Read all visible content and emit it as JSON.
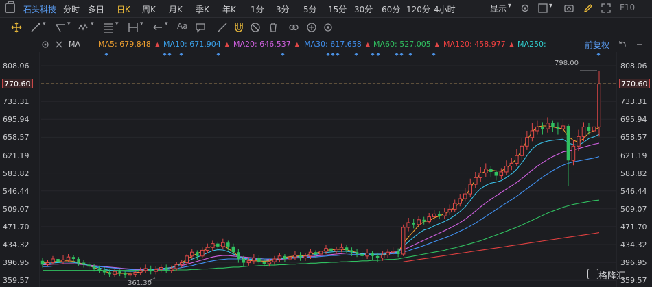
{
  "header": {
    "stock_name": "石头科技",
    "periods": [
      "分时",
      "多日",
      "日K",
      "周K",
      "月K",
      "季K",
      "年K",
      "1分",
      "3分",
      "5分",
      "15分",
      "30分",
      "60分",
      "120分",
      "4小时"
    ],
    "active_period": "日K",
    "display_label": "显示",
    "f10_label": "F10"
  },
  "indicator_row": {
    "ma_label": "MA",
    "items": [
      {
        "label": "MA5: 679.848",
        "color": "#f0a030"
      },
      {
        "label": "MA10: 671.904",
        "color": "#3aa0e8"
      },
      {
        "label": "MA20: 646.537",
        "color": "#d060e0"
      },
      {
        "label": "MA30: 617.658",
        "color": "#4090f0"
      },
      {
        "label": "MA60: 527.005",
        "color": "#30c060"
      },
      {
        "label": "MA120: 458.977",
        "color": "#f04040"
      },
      {
        "label": "MA250:",
        "color": "#30d0d0"
      }
    ],
    "adjust_label": "前复权"
  },
  "price_axis": {
    "labels": [
      "808.06",
      "770.60",
      "733.31",
      "695.94",
      "658.57",
      "621.19",
      "583.82",
      "546.44",
      "509.07",
      "471.70",
      "434.32",
      "396.95",
      "359.57"
    ],
    "current_price": "770.60",
    "high_annotation": "798.00",
    "low_annotation": "361.30"
  },
  "chart_data": {
    "type": "candlestick",
    "ylim": [
      359.57,
      808.06
    ],
    "high_label": 798.0,
    "low_label": 361.3,
    "last_price": 770.6,
    "ma_values": {
      "MA5": 679.848,
      "MA10": 671.904,
      "MA20": 646.537,
      "MA30": 617.658,
      "MA60": 527.005,
      "MA120": 458.977
    },
    "candles": [
      [
        400,
        392,
        406,
        386
      ],
      [
        392,
        396,
        402,
        388
      ],
      [
        396,
        404,
        410,
        392
      ],
      [
        404,
        398,
        408,
        394
      ],
      [
        398,
        402,
        412,
        394
      ],
      [
        402,
        408,
        414,
        398
      ],
      [
        408,
        404,
        412,
        398
      ],
      [
        404,
        396,
        408,
        390
      ],
      [
        396,
        392,
        402,
        386
      ],
      [
        392,
        388,
        398,
        382
      ],
      [
        388,
        384,
        394,
        378
      ],
      [
        384,
        380,
        390,
        374
      ],
      [
        380,
        376,
        386,
        370
      ],
      [
        376,
        372,
        382,
        366
      ],
      [
        372,
        378,
        384,
        366
      ],
      [
        378,
        374,
        382,
        368
      ],
      [
        374,
        370,
        380,
        364
      ],
      [
        370,
        372,
        378,
        362
      ],
      [
        372,
        376,
        380,
        366
      ],
      [
        376,
        380,
        386,
        370
      ],
      [
        380,
        384,
        392,
        374
      ],
      [
        384,
        378,
        390,
        372
      ],
      [
        378,
        382,
        388,
        372
      ],
      [
        382,
        386,
        392,
        376
      ],
      [
        386,
        380,
        392,
        374
      ],
      [
        380,
        384,
        390,
        374
      ],
      [
        384,
        392,
        398,
        380
      ],
      [
        392,
        396,
        402,
        386
      ],
      [
        396,
        410,
        414,
        390
      ],
      [
        410,
        418,
        424,
        404
      ],
      [
        418,
        410,
        422,
        402
      ],
      [
        410,
        422,
        428,
        406
      ],
      [
        422,
        428,
        436,
        416
      ],
      [
        428,
        436,
        442,
        420
      ],
      [
        436,
        430,
        440,
        422
      ],
      [
        430,
        438,
        446,
        424
      ],
      [
        438,
        430,
        442,
        422
      ],
      [
        430,
        418,
        436,
        412
      ],
      [
        418,
        404,
        424,
        396
      ],
      [
        404,
        396,
        410,
        388
      ],
      [
        396,
        400,
        406,
        390
      ],
      [
        400,
        406,
        414,
        394
      ],
      [
        406,
        398,
        412,
        392
      ],
      [
        398,
        394,
        404,
        388
      ],
      [
        394,
        398,
        404,
        388
      ],
      [
        398,
        404,
        410,
        392
      ],
      [
        404,
        410,
        416,
        398
      ],
      [
        410,
        404,
        414,
        398
      ],
      [
        404,
        408,
        414,
        398
      ],
      [
        408,
        412,
        420,
        402
      ],
      [
        412,
        406,
        418,
        400
      ],
      [
        406,
        410,
        416,
        400
      ],
      [
        410,
        418,
        424,
        404
      ],
      [
        418,
        414,
        422,
        406
      ],
      [
        414,
        420,
        428,
        408
      ],
      [
        420,
        426,
        434,
        414
      ],
      [
        426,
        420,
        432,
        412
      ],
      [
        420,
        424,
        430,
        414
      ],
      [
        424,
        428,
        436,
        418
      ],
      [
        428,
        422,
        434,
        416
      ],
      [
        422,
        418,
        428,
        410
      ],
      [
        418,
        414,
        424,
        408
      ],
      [
        414,
        410,
        420,
        404
      ],
      [
        410,
        416,
        424,
        404
      ],
      [
        416,
        410,
        420,
        402
      ],
      [
        410,
        406,
        416,
        398
      ],
      [
        406,
        412,
        420,
        400
      ],
      [
        412,
        418,
        424,
        406
      ],
      [
        418,
        420,
        428,
        412
      ],
      [
        420,
        414,
        426,
        408
      ],
      [
        414,
        470,
        476,
        410
      ],
      [
        470,
        480,
        490,
        462
      ],
      [
        480,
        476,
        488,
        468
      ],
      [
        476,
        486,
        494,
        470
      ],
      [
        486,
        482,
        492,
        476
      ],
      [
        482,
        492,
        500,
        478
      ],
      [
        492,
        498,
        506,
        486
      ],
      [
        498,
        494,
        504,
        488
      ],
      [
        494,
        502,
        510,
        488
      ],
      [
        502,
        508,
        518,
        496
      ],
      [
        508,
        520,
        528,
        502
      ],
      [
        520,
        530,
        540,
        514
      ],
      [
        530,
        540,
        552,
        524
      ],
      [
        540,
        560,
        572,
        534
      ],
      [
        560,
        574,
        586,
        552
      ],
      [
        574,
        584,
        596,
        566
      ],
      [
        584,
        592,
        604,
        576
      ],
      [
        592,
        586,
        598,
        576
      ],
      [
        586,
        578,
        590,
        568
      ],
      [
        578,
        586,
        594,
        570
      ],
      [
        586,
        598,
        610,
        580
      ],
      [
        598,
        604,
        616,
        590
      ],
      [
        604,
        620,
        634,
        598
      ],
      [
        620,
        640,
        656,
        612
      ],
      [
        640,
        658,
        672,
        632
      ],
      [
        658,
        672,
        688,
        650
      ],
      [
        672,
        680,
        694,
        664
      ],
      [
        680,
        676,
        690,
        664
      ],
      [
        676,
        688,
        700,
        668
      ],
      [
        688,
        680,
        694,
        670
      ],
      [
        680,
        676,
        690,
        664
      ],
      [
        676,
        682,
        696,
        668
      ],
      [
        682,
        610,
        686,
        556
      ],
      [
        610,
        640,
        652,
        600
      ],
      [
        640,
        660,
        674,
        630
      ],
      [
        660,
        680,
        690,
        650
      ],
      [
        680,
        672,
        688,
        664
      ],
      [
        672,
        680,
        692,
        664
      ],
      [
        680,
        770,
        798,
        660
      ]
    ],
    "ma_series": {
      "MA5": [
        396,
        397,
        398,
        399,
        400,
        400,
        399,
        396,
        393,
        390,
        386,
        382,
        378,
        375,
        374,
        374,
        374,
        374,
        375,
        377,
        380,
        382,
        383,
        384,
        384,
        386,
        390,
        396,
        403,
        410,
        415,
        420,
        426,
        432,
        434,
        432,
        426,
        418,
        410,
        404,
        401,
        400,
        400,
        399,
        400,
        403,
        405,
        407,
        409,
        410,
        410,
        411,
        414,
        416,
        419,
        422,
        423,
        424,
        424,
        423,
        420,
        417,
        414,
        413,
        412,
        412,
        412,
        414,
        416,
        418,
        436,
        450,
        462,
        474,
        482,
        484,
        490,
        494,
        498,
        504,
        512,
        522,
        534,
        552,
        570,
        582,
        588,
        590,
        588,
        588,
        594,
        602,
        614,
        632,
        652,
        670,
        680,
        682,
        682,
        680,
        678,
        676,
        660,
        652,
        648,
        656,
        668,
        672,
        680
      ],
      "MA20": [
        392,
        392,
        393,
        393,
        394,
        394,
        394,
        393,
        392,
        391,
        390,
        389,
        388,
        387,
        386,
        385,
        384,
        383,
        382,
        382,
        382,
        382,
        383,
        384,
        385,
        386,
        388,
        390,
        393,
        396,
        399,
        402,
        405,
        408,
        410,
        411,
        411,
        410,
        409,
        408,
        407,
        406,
        405,
        404,
        403,
        403,
        403,
        404,
        405,
        406,
        407,
        408,
        409,
        410,
        411,
        412,
        413,
        414,
        415,
        416,
        416,
        416,
        416,
        416,
        416,
        416,
        416,
        417,
        418,
        419,
        423,
        428,
        433,
        438,
        443,
        448,
        453,
        458,
        463,
        468,
        474,
        480,
        487,
        495,
        504,
        513,
        521,
        529,
        536,
        543,
        550,
        557,
        564,
        572,
        581,
        590,
        598,
        605,
        612,
        618,
        623,
        628,
        630,
        632,
        635,
        638,
        641,
        644,
        646
      ],
      "MA30": [
        388,
        388,
        389,
        389,
        389,
        389,
        389,
        389,
        389,
        389,
        388,
        388,
        387,
        386,
        385,
        384,
        383,
        382,
        381,
        381,
        381,
        381,
        381,
        382,
        382,
        383,
        384,
        386,
        388,
        390,
        393,
        395,
        398,
        400,
        402,
        403,
        404,
        404,
        404,
        404,
        404,
        404,
        404,
        404,
        404,
        404,
        404,
        405,
        405,
        406,
        406,
        407,
        408,
        408,
        409,
        410,
        411,
        411,
        412,
        412,
        413,
        413,
        413,
        413,
        413,
        414,
        414,
        414,
        415,
        415,
        418,
        421,
        425,
        428,
        432,
        436,
        440,
        444,
        448,
        452,
        457,
        462,
        467,
        473,
        479,
        486,
        493,
        500,
        507,
        514,
        521,
        528,
        535,
        543,
        551,
        559,
        567,
        575,
        582,
        589,
        595,
        600,
        604,
        607,
        609,
        611,
        613,
        615,
        618
      ],
      "MA60": [
        380,
        380,
        380,
        380,
        380,
        380,
        380,
        380,
        380,
        380,
        380,
        380,
        380,
        380,
        380,
        380,
        380,
        380,
        380,
        380,
        380,
        380,
        380,
        380,
        380,
        380,
        381,
        381,
        381,
        382,
        382,
        383,
        383,
        384,
        385,
        385,
        386,
        387,
        387,
        388,
        389,
        389,
        390,
        390,
        391,
        391,
        392,
        392,
        393,
        393,
        394,
        394,
        395,
        395,
        396,
        396,
        397,
        397,
        398,
        398,
        399,
        399,
        400,
        400,
        401,
        401,
        402,
        403,
        403,
        404,
        406,
        408,
        410,
        412,
        414,
        416,
        418,
        420,
        422,
        425,
        427,
        430,
        433,
        436,
        439,
        442,
        446,
        450,
        454,
        458,
        462,
        466,
        470,
        475,
        480,
        485,
        490,
        495,
        500,
        504,
        508,
        512,
        515,
        518,
        520,
        522,
        524,
        526,
        527
      ],
      "MA120": [
        null,
        null,
        null,
        null,
        null,
        null,
        null,
        null,
        null,
        null,
        null,
        null,
        null,
        null,
        null,
        null,
        null,
        null,
        null,
        null,
        null,
        null,
        null,
        null,
        null,
        null,
        null,
        null,
        null,
        null,
        null,
        null,
        null,
        null,
        null,
        null,
        null,
        null,
        null,
        null,
        null,
        null,
        null,
        null,
        null,
        null,
        null,
        null,
        null,
        null,
        null,
        null,
        null,
        null,
        null,
        null,
        null,
        null,
        null,
        null,
        null,
        null,
        null,
        null,
        null,
        null,
        null,
        null,
        null,
        null,
        null,
        null,
        null,
        null,
        null,
        null,
        null,
        null,
        null,
        null,
        null,
        null,
        null,
        null,
        null,
        null,
        null,
        null,
        null,
        null,
        null,
        null,
        null,
        null,
        null,
        null,
        null,
        null,
        null,
        null,
        null,
        null,
        null,
        null,
        null,
        null,
        null,
        null,
        null
      ]
    },
    "ma120_points": [
      [
        71,
        398
      ],
      [
        80,
        400
      ],
      [
        90,
        403
      ],
      [
        100,
        407
      ],
      [
        108,
        412
      ],
      [
        110,
        413
      ],
      [
        111,
        414
      ],
      [
        112,
        415
      ],
      [
        113,
        416
      ],
      [
        114,
        417
      ],
      [
        115,
        418
      ],
      [
        116,
        420
      ],
      [
        117,
        421
      ],
      [
        118,
        422
      ],
      [
        119,
        423
      ],
      [
        120,
        424
      ],
      [
        121,
        425
      ],
      [
        122,
        426
      ],
      [
        123,
        427
      ],
      [
        124,
        428
      ],
      [
        125,
        429
      ],
      [
        126,
        430
      ],
      [
        127,
        431
      ],
      [
        128,
        432
      ],
      [
        129,
        433
      ],
      [
        130,
        434
      ],
      [
        131,
        435
      ],
      [
        132,
        436
      ],
      [
        133,
        437
      ],
      [
        134,
        438
      ],
      [
        135,
        440
      ],
      [
        136,
        441
      ],
      [
        137,
        442
      ],
      [
        138,
        443
      ],
      [
        139,
        444
      ],
      [
        140,
        445
      ],
      [
        141,
        446
      ],
      [
        142,
        447
      ],
      [
        143,
        448
      ],
      [
        144,
        449
      ],
      [
        145,
        450
      ],
      [
        146,
        451
      ],
      [
        147,
        452
      ],
      [
        148,
        453
      ],
      [
        149,
        454
      ],
      [
        150,
        455
      ],
      [
        151,
        456
      ],
      [
        152,
        457
      ],
      [
        153,
        459
      ]
    ]
  },
  "watermark": {
    "text": "格隆汇"
  }
}
